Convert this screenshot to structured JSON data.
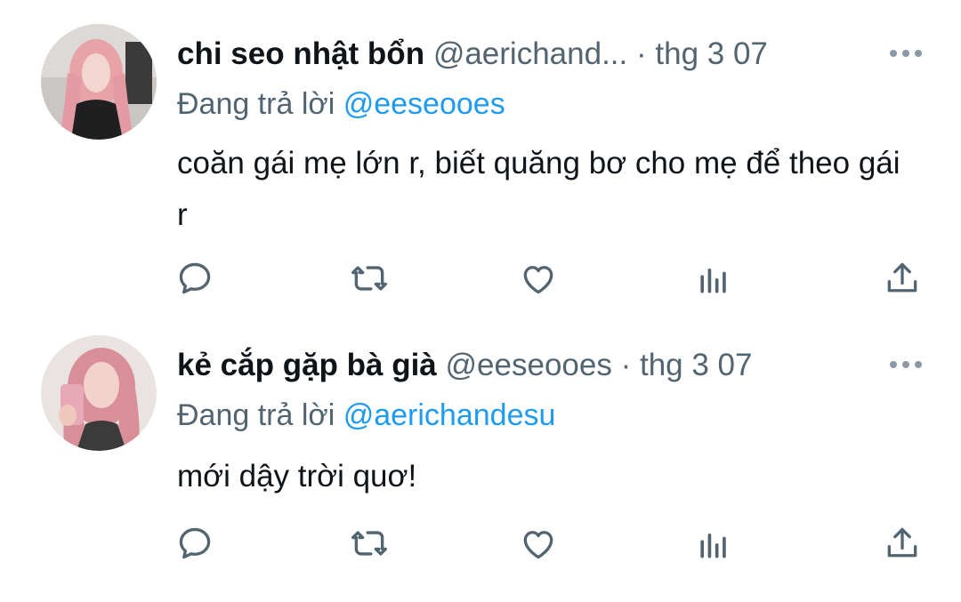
{
  "tweets": [
    {
      "name": "chi seo nhật bổn",
      "handle": "@aerichand...",
      "separator": "·",
      "date": "thg 3 07",
      "reply_prefix": "Đang trả lời",
      "reply_to": "@eeseooes",
      "text": "coăn gái mẹ lớn r, biết quăng bơ cho mẹ để theo gái r",
      "avatar_icon": "profile-photo",
      "actions": [
        "reply-icon",
        "retweet-icon",
        "like-icon",
        "views-icon",
        "share-icon"
      ]
    },
    {
      "name": "kẻ cắp gặp bà già",
      "handle": "@eeseooes",
      "separator": "·",
      "date": "thg 3 07",
      "reply_prefix": "Đang trả lời",
      "reply_to": "@aerichandesu",
      "text": "mới dậy trời quơ!",
      "avatar_icon": "profile-photo",
      "actions": [
        "reply-icon",
        "retweet-icon",
        "like-icon",
        "views-icon",
        "share-icon"
      ]
    }
  ],
  "colors": {
    "text": "#0f1419",
    "secondary": "#536471",
    "accent": "#1d9bf0",
    "icon": "#536471"
  }
}
